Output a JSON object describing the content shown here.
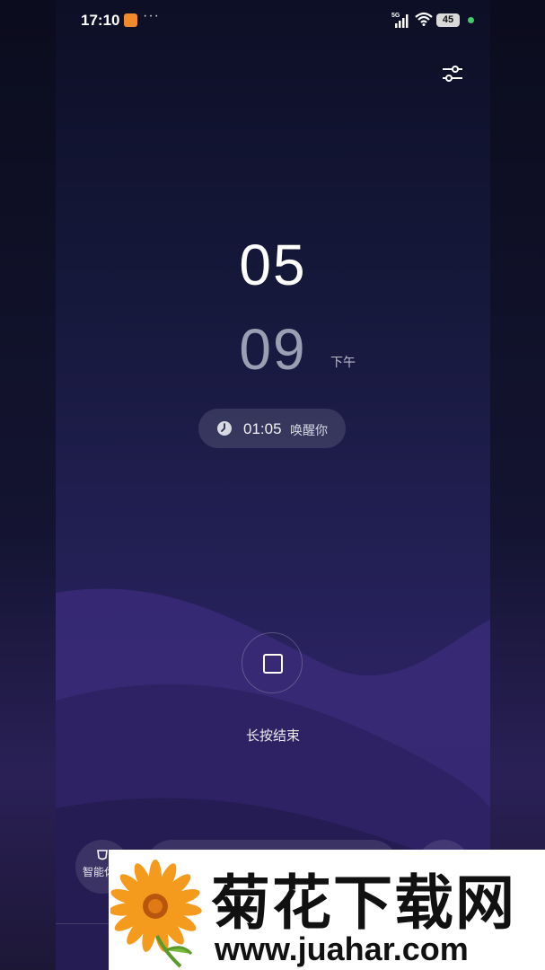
{
  "status_bar": {
    "time": "17:10",
    "more": "···",
    "network": "5G",
    "battery": "45",
    "app_badge_color": "#f08a2c",
    "dot_color": "#3fd06b",
    "icons": [
      "app-notification-icon",
      "signal-icon",
      "wifi-icon",
      "battery-icon"
    ]
  },
  "toolbar": {
    "settings_icon": "sliders-icon"
  },
  "clock": {
    "hour": "05",
    "minute": "09",
    "period": "下午"
  },
  "alarm": {
    "icon": "clock-icon",
    "time": "01:05",
    "label": "唤醒你"
  },
  "stop": {
    "icon": "stop-square-icon",
    "label": "长按结束"
  },
  "bottom": {
    "smart_label": "智能休",
    "smart_icon": "cup-icon"
  },
  "watermark": {
    "title": "菊花下载网",
    "url": "www.juahar.com"
  }
}
